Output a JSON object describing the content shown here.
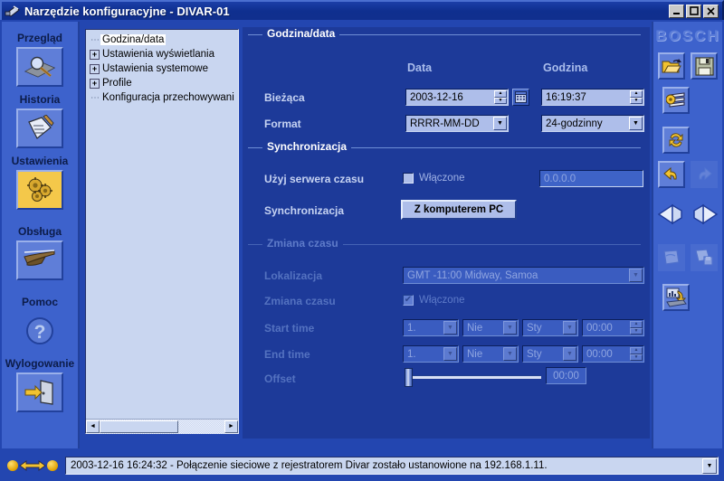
{
  "window": {
    "title": "Narzędzie konfiguracyjne - DIVAR-01",
    "minimize_label": "_",
    "maximize_label": "□",
    "close_label": "✕"
  },
  "sidebar": {
    "items": [
      {
        "label": "Przegląd",
        "icon": "magnifier-recorder-icon",
        "active": false
      },
      {
        "label": "Historia",
        "icon": "clipboard-pen-icon",
        "active": false
      },
      {
        "label": "Ustawienia",
        "icon": "gears-icon",
        "active": true
      },
      {
        "label": "Obsługa",
        "icon": "joystick-icon",
        "active": false
      },
      {
        "label": "Pomoc",
        "icon": "question-mark-icon",
        "active": false
      },
      {
        "label": "Wylogowanie",
        "icon": "exit-door-icon",
        "active": false
      }
    ]
  },
  "tree": {
    "items": [
      {
        "label": "Godzina/data",
        "expandable": false,
        "selected": true
      },
      {
        "label": "Ustawienia wyświetlania",
        "expandable": true,
        "selected": false
      },
      {
        "label": "Ustawienia systemowe",
        "expandable": true,
        "selected": false
      },
      {
        "label": "Profile",
        "expandable": true,
        "selected": false
      },
      {
        "label": "Konfiguracja przechowywani",
        "expandable": false,
        "selected": false
      }
    ],
    "expand_glyph": "+",
    "scroll_left": "◄",
    "scroll_right": "►"
  },
  "main": {
    "datetime_group": {
      "title": "Godzina/data",
      "col_date": "Data",
      "col_time": "Godzina",
      "current_label": "Bieżąca",
      "current_date": "2003-12-16",
      "current_time": "16:19:37",
      "format_label": "Format",
      "date_format": "RRRR-MM-DD",
      "time_format": "24-godzinny",
      "calendar_icon": "calendar-icon"
    },
    "sync_group": {
      "title": "Synchronizacja",
      "timeserver_label": "Użyj serwera czasu",
      "enabled_label": "Włączone",
      "enabled_checked": false,
      "ip_value": "0.0.0.0",
      "sync_label": "Synchronizacja",
      "sync_button": "Z komputerem PC"
    },
    "dst_group": {
      "title": "Zmiana czasu",
      "disabled": true,
      "location_label": "Lokalizacja",
      "location_value": "GMT -11:00 Midway, Samoa",
      "dst_label": "Zmiana czasu",
      "dst_enabled_label": "Włączone",
      "dst_enabled_checked": true,
      "start_label": "Start time",
      "start_week": "1.",
      "start_day": "Nie",
      "start_month": "Sty",
      "start_time": "00:00",
      "end_label": "End time",
      "end_week": "1.",
      "end_day": "Nie",
      "end_month": "Sty",
      "end_time": "00:00",
      "offset_label": "Offset",
      "offset_value": "00:00"
    }
  },
  "toolbar": {
    "brand": "BOSCH",
    "buttons": [
      {
        "name": "open-file-icon",
        "enabled": true
      },
      {
        "name": "save-file-icon",
        "enabled": true
      },
      {
        "name": "configure-list-icon",
        "enabled": true
      },
      {
        "name": "refresh-icon",
        "enabled": true
      },
      {
        "name": "undo-icon",
        "enabled": true
      },
      {
        "name": "redo-icon",
        "enabled": false
      },
      {
        "name": "arrow-left-icon",
        "enabled": true
      },
      {
        "name": "arrow-right-icon",
        "enabled": true
      },
      {
        "name": "page-load-icon",
        "enabled": false
      },
      {
        "name": "page-save-icon",
        "enabled": false
      },
      {
        "name": "upload-to-device-icon",
        "enabled": true
      }
    ]
  },
  "statusbar": {
    "message": "2003-12-16 16:24:32 - Połączenie sieciowe z rejestratorem Divar zostało ustanowione na 192.168.1.11.",
    "dropdown_glyph": "▼",
    "led_left": "led-yellow",
    "led_right": "led-yellow",
    "connection_icon": "double-arrow-icon"
  },
  "colors": {
    "window_bg": "#2346b0",
    "panel_bg": "#1d3a99",
    "sidebar_bg": "#3d62cc",
    "accent_active": "#f4c84a",
    "field_bg": "#aebeea",
    "tree_bg": "#c9d6f0"
  }
}
